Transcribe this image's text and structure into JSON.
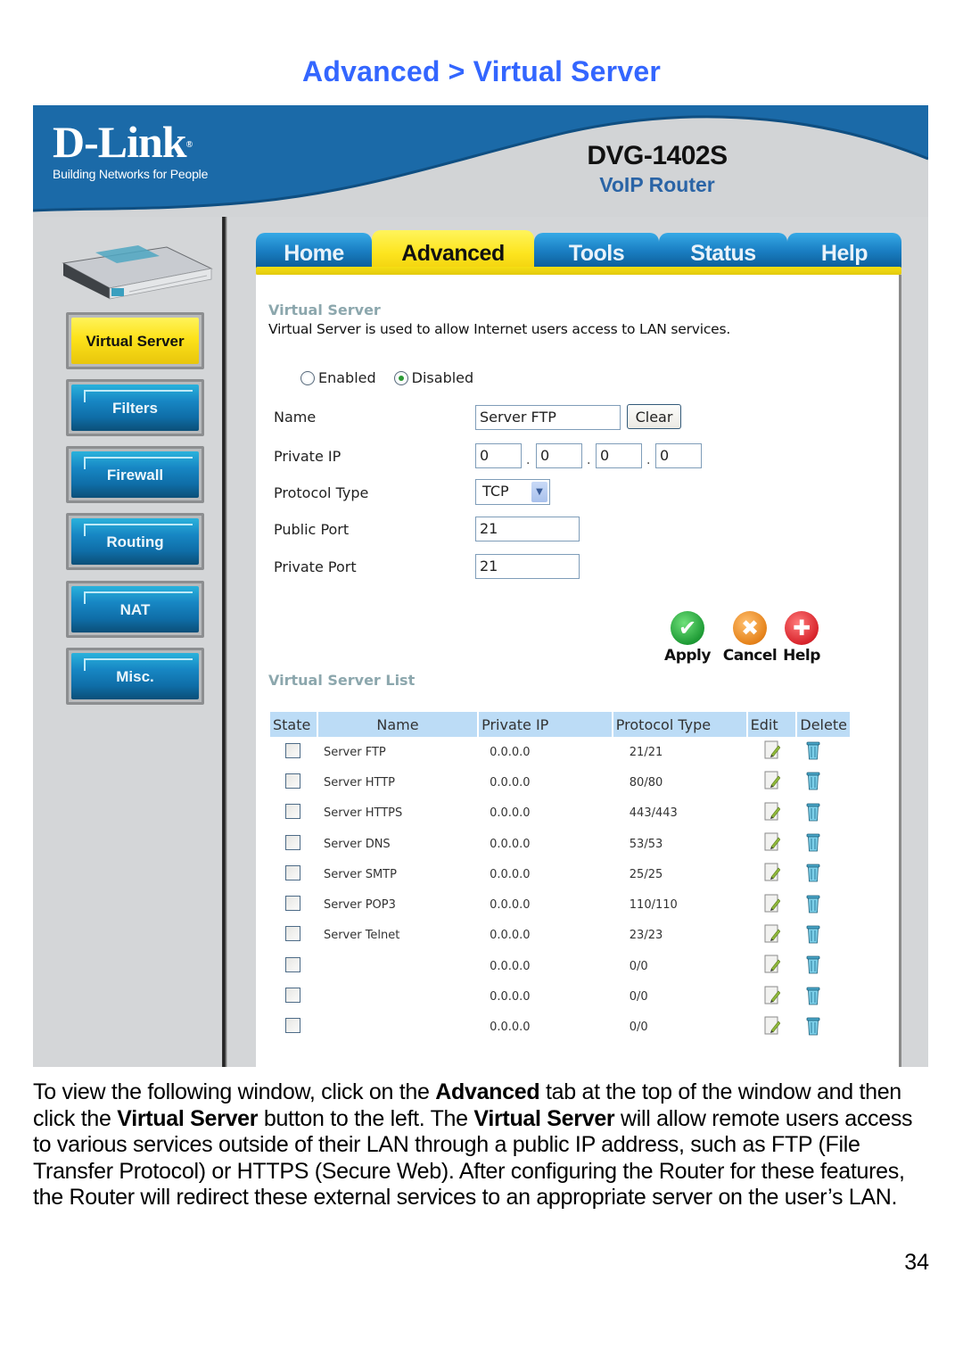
{
  "page": {
    "title": "Advanced > Virtual Server",
    "page_number": "34",
    "body_paragraph": [
      {
        "text": "To view the following window, click on the ",
        "bold": false
      },
      {
        "text": "Advanced",
        "bold": true
      },
      {
        "text": " tab at the top of the window and then click the ",
        "bold": false
      },
      {
        "text": "Virtual Server",
        "bold": true
      },
      {
        "text": " button to the left. The ",
        "bold": false
      },
      {
        "text": "Virtual Server",
        "bold": true
      },
      {
        "text": " will allow remote users access to various services outside of their LAN through a public IP address, such as FTP (File Transfer Protocol) or HTTPS (Secure Web). After configuring the Router for these features, the Router will redirect these external services to an appropriate server on the user’s LAN.",
        "bold": false
      }
    ]
  },
  "banner": {
    "brand": "D-Link",
    "brand_mark": "®",
    "tagline": "Building Networks for People",
    "model": "DVG-1402S",
    "product": "VoIP Router",
    "colors": {
      "banner_blue": "#1b6aa8",
      "accent_yellow": "#fde21a",
      "tab_blue": "#1a7fc3"
    }
  },
  "tabs": [
    {
      "label": "Home",
      "active": false
    },
    {
      "label": "Advanced",
      "active": true
    },
    {
      "label": "Tools",
      "active": false
    },
    {
      "label": "Status",
      "active": false
    },
    {
      "label": "Help",
      "active": false
    }
  ],
  "sidebar": {
    "device_image": "router-image",
    "items": [
      {
        "label": "Virtual Server",
        "active": true
      },
      {
        "label": "Filters",
        "active": false
      },
      {
        "label": "Firewall",
        "active": false
      },
      {
        "label": "Routing",
        "active": false
      },
      {
        "label": "NAT",
        "active": false
      },
      {
        "label": "Misc.",
        "active": false
      }
    ]
  },
  "form": {
    "section_title": "Virtual Server",
    "description": "Virtual Server is used to allow Internet users access to LAN services.",
    "state_options": [
      {
        "label": "Enabled",
        "checked": false
      },
      {
        "label": "Disabled",
        "checked": true
      }
    ],
    "name_label": "Name",
    "name_value": "Server FTP",
    "clear_label": "Clear",
    "private_ip_label": "Private IP",
    "private_ip": [
      "0",
      "0",
      "0",
      "0"
    ],
    "ip_separator": ".",
    "protocol_label": "Protocol Type",
    "protocol_value": "TCP",
    "public_port_label": "Public Port",
    "public_port_value": "21",
    "private_port_label": "Private Port",
    "private_port_value": "21"
  },
  "actions": {
    "apply": {
      "label": "Apply",
      "icon": "check-icon",
      "glyph": "✔"
    },
    "cancel": {
      "label": "Cancel",
      "icon": "x-icon",
      "glyph": "✖"
    },
    "help": {
      "label": "Help",
      "icon": "plus-icon",
      "glyph": "✚"
    }
  },
  "list": {
    "section_title": "Virtual Server List",
    "columns": [
      "State",
      "Name",
      "Private IP",
      "Protocol Type",
      "Edit",
      "Delete"
    ],
    "rows": [
      {
        "checked": false,
        "name": "Server FTP",
        "ip": "0.0.0.0",
        "ports": "21/21"
      },
      {
        "checked": false,
        "name": "Server HTTP",
        "ip": "0.0.0.0",
        "ports": "80/80"
      },
      {
        "checked": false,
        "name": "Server HTTPS",
        "ip": "0.0.0.0",
        "ports": "443/443"
      },
      {
        "checked": false,
        "name": "Server DNS",
        "ip": "0.0.0.0",
        "ports": "53/53"
      },
      {
        "checked": false,
        "name": "Server SMTP",
        "ip": "0.0.0.0",
        "ports": "25/25"
      },
      {
        "checked": false,
        "name": "Server POP3",
        "ip": "0.0.0.0",
        "ports": "110/110"
      },
      {
        "checked": false,
        "name": "Server Telnet",
        "ip": "0.0.0.0",
        "ports": "23/23"
      },
      {
        "checked": false,
        "name": "",
        "ip": "0.0.0.0",
        "ports": "0/0"
      },
      {
        "checked": false,
        "name": "",
        "ip": "0.0.0.0",
        "ports": "0/0"
      },
      {
        "checked": false,
        "name": "",
        "ip": "0.0.0.0",
        "ports": "0/0"
      }
    ]
  }
}
